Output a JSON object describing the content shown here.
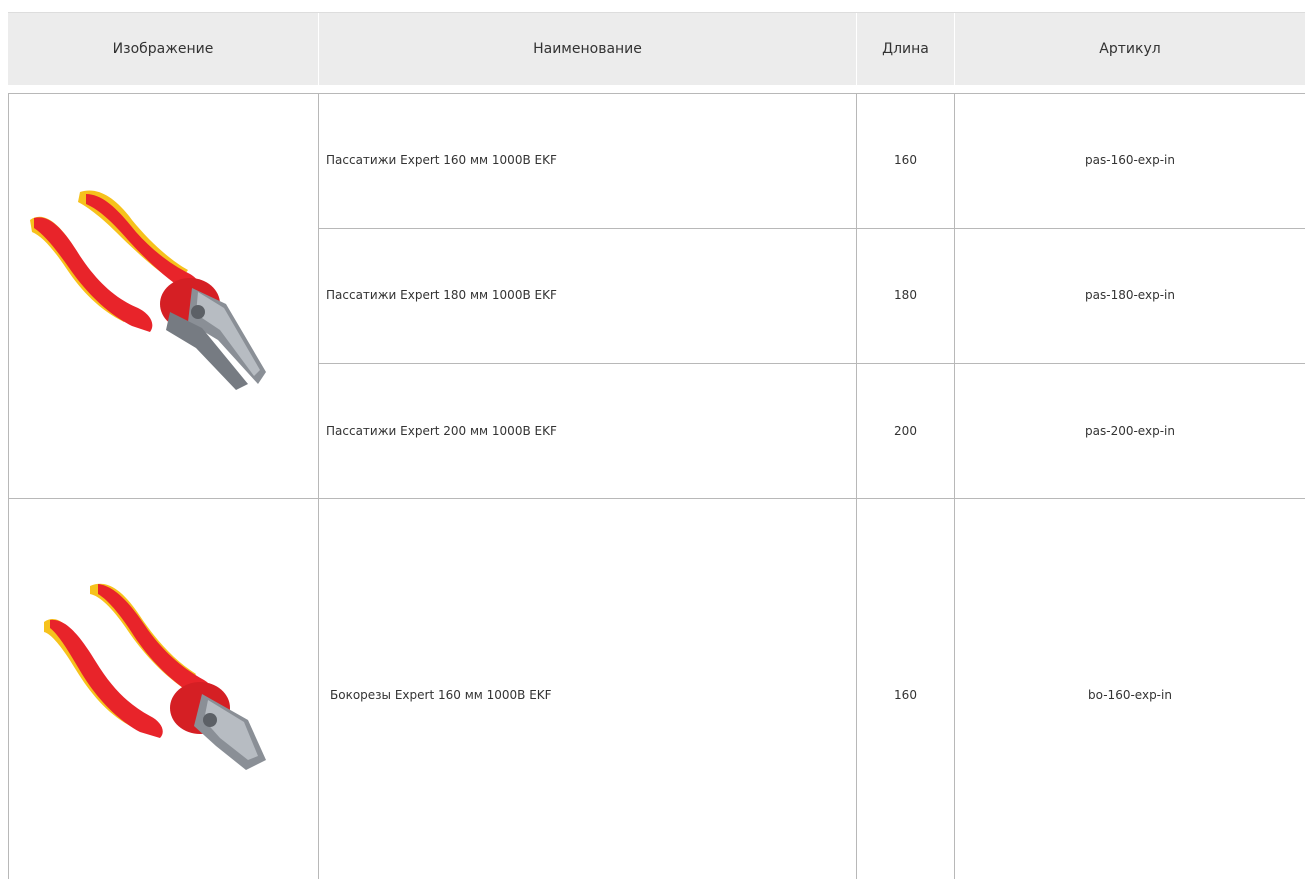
{
  "table": {
    "headers": {
      "image": "Изображение",
      "name": "Наименование",
      "length": "Длина",
      "article": "Артикул"
    },
    "rows": [
      {
        "name": "Пассатижи Expert 160 мм 1000В EKF",
        "length": "160",
        "article": "pas-160-exp-in"
      },
      {
        "name": "Пассатижи Expert 180 мм 1000В EKF",
        "length": "180",
        "article": "pas-180-exp-in"
      },
      {
        "name": "Пассатижи Expert 200 мм 1000В EKF",
        "length": "200",
        "article": "pas-200-exp-in"
      },
      {
        "name": "Бокорезы Expert 160 мм 1000В EKF",
        "length": "160",
        "article": "bo-160-exp-in"
      }
    ],
    "images": [
      {
        "icon": "combination-pliers-icon"
      },
      {
        "icon": "diagonal-cutters-icon"
      }
    ]
  },
  "colors": {
    "header_bg": "#ececec",
    "grid": "#b8b8b8",
    "handle_red": "#e8242a",
    "handle_yellow": "#f6c21c",
    "steel": "#8a8f96"
  }
}
